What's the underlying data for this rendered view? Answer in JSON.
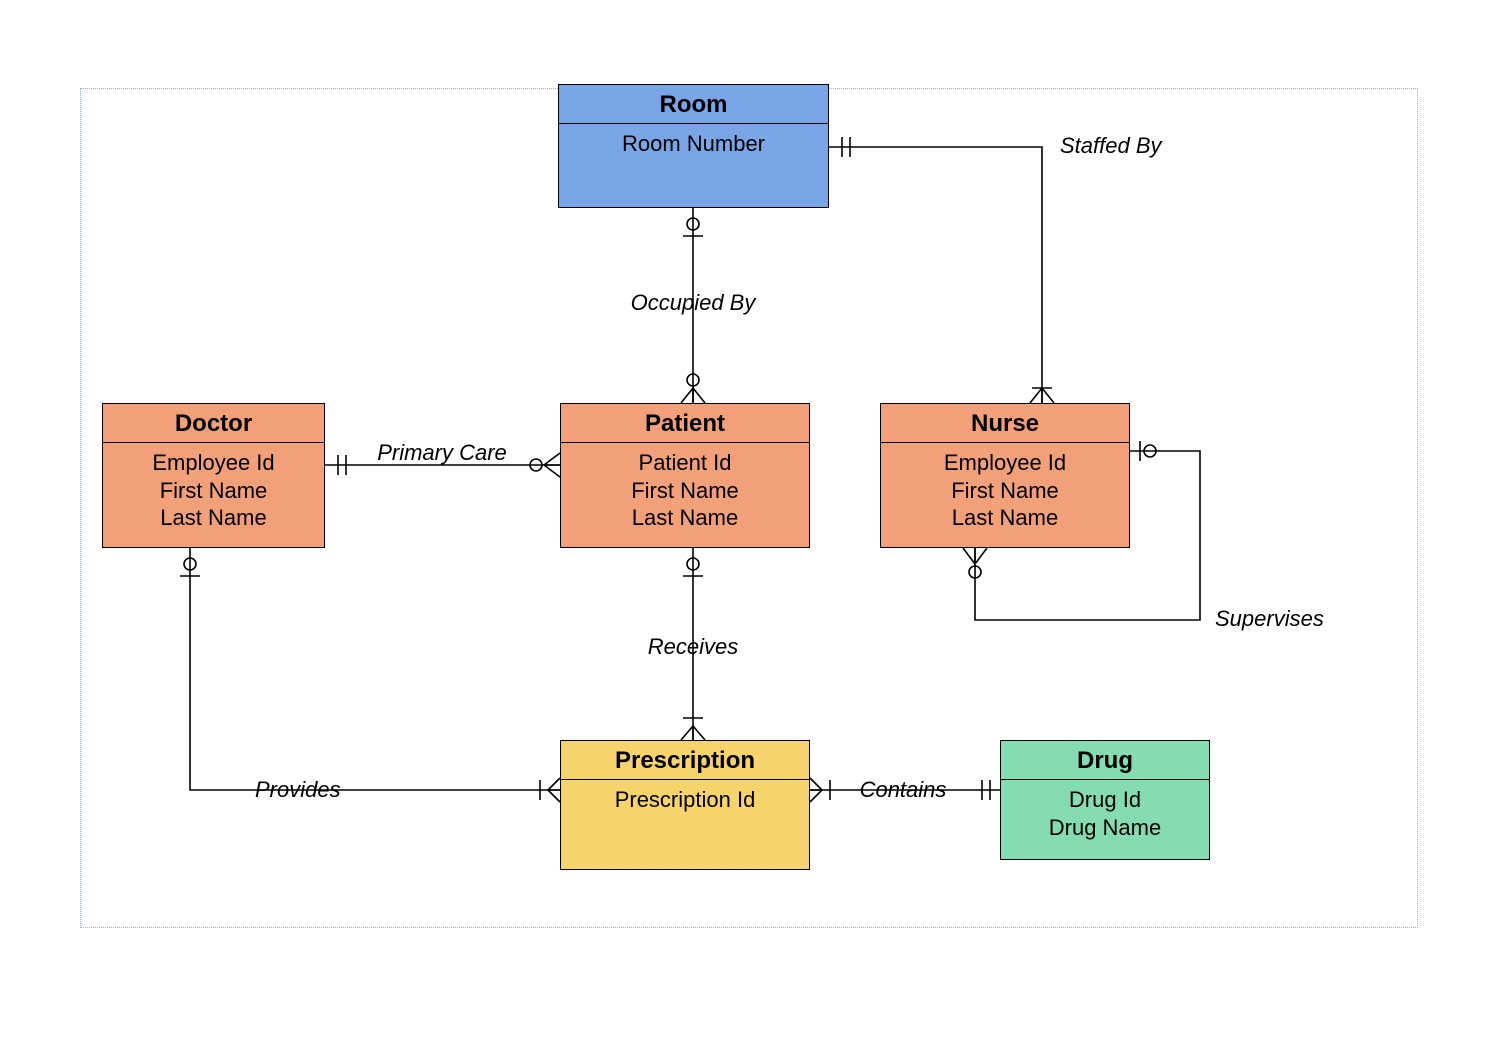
{
  "colors": {
    "blue": "#7aa6e8",
    "orange": "#f1a07a",
    "yellow": "#f6d36b",
    "green": "#84dcb0"
  },
  "entities": {
    "room": {
      "title": "Room",
      "attributes": [
        "Room Number"
      ]
    },
    "doctor": {
      "title": "Doctor",
      "attributes": [
        "Employee Id",
        "First Name",
        "Last Name"
      ]
    },
    "patient": {
      "title": "Patient",
      "attributes": [
        "Patient Id",
        "First Name",
        "Last Name"
      ]
    },
    "nurse": {
      "title": "Nurse",
      "attributes": [
        "Employee Id",
        "First Name",
        "Last Name"
      ]
    },
    "prescription": {
      "title": "Prescription",
      "attributes": [
        "Prescription Id"
      ]
    },
    "drug": {
      "title": "Drug",
      "attributes": [
        "Drug Id",
        "Drug Name"
      ]
    }
  },
  "relationships": {
    "staffed_by": {
      "label": "Staffed By"
    },
    "occupied_by": {
      "label": "Occupied By"
    },
    "primary_care": {
      "label": "Primary Care"
    },
    "supervises": {
      "label": "Supervises"
    },
    "receives": {
      "label": "Receives"
    },
    "provides": {
      "label": "Provides"
    },
    "contains": {
      "label": "Contains"
    }
  }
}
